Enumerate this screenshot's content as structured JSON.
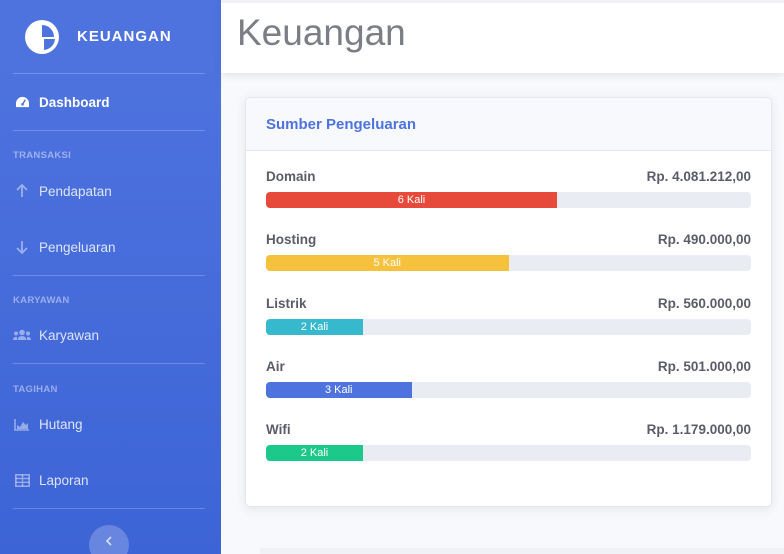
{
  "sidebar": {
    "brand": "KEUANGAN",
    "dashboard": "Dashboard",
    "sections": {
      "transaksi": "TRANSAKSI",
      "karyawan": "KARYAWAN",
      "tagihan": "TAGIHAN"
    },
    "items": {
      "pendapatan": "Pendapatan",
      "pengeluaran": "Pengeluaran",
      "karyawan": "Karyawan",
      "hutang": "Hutang",
      "laporan": "Laporan"
    },
    "toggle_icon": "chevron-left-icon"
  },
  "header": {
    "title": "Keuangan"
  },
  "card": {
    "title": "Sumber Pengeluaran",
    "rows": [
      {
        "name": "Domain",
        "amount": "Rp. 4.081.212,00",
        "count_label": "6 Kali",
        "progress": 0.6,
        "color": "#e74a3b"
      },
      {
        "name": "Hosting",
        "amount": "Rp. 490.000,00",
        "count_label": "5 Kali",
        "progress": 0.5,
        "color": "#f6c23e"
      },
      {
        "name": "Listrik",
        "amount": "Rp. 560.000,00",
        "count_label": "2 Kali",
        "progress": 0.2,
        "color": "#36b9cc"
      },
      {
        "name": "Air",
        "amount": "Rp. 501.000,00",
        "count_label": "3 Kali",
        "progress": 0.3,
        "color": "#4e73df"
      },
      {
        "name": "Wifi",
        "amount": "Rp. 1.179.000,00",
        "count_label": "2 Kali",
        "progress": 0.2,
        "color": "#1cc88a"
      }
    ]
  }
}
